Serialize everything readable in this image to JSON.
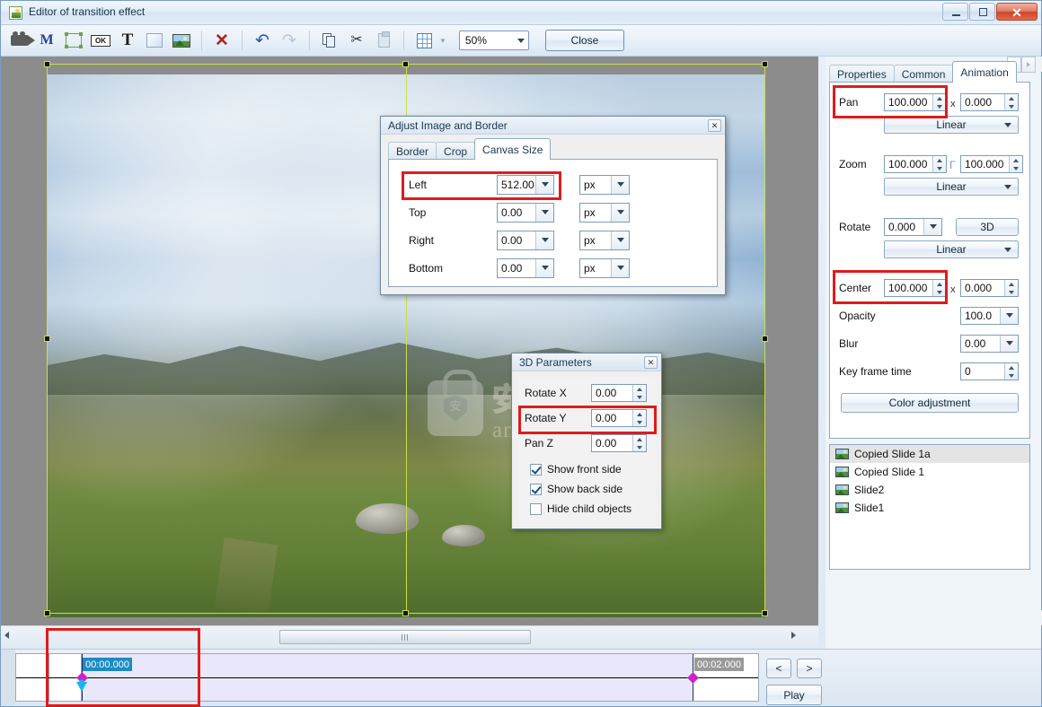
{
  "window": {
    "title": "Editor of transition effect",
    "icon": "app-icon",
    "minimize": "minimize-icon",
    "maximize": "maximize-icon",
    "close": "✕"
  },
  "toolbar": {
    "items": [
      {
        "name": "video-camera-icon",
        "label": ""
      },
      {
        "name": "mask-m-icon",
        "label": "M"
      },
      {
        "name": "selection-frame-icon",
        "label": ""
      },
      {
        "name": "button-ok-icon",
        "label": "OK"
      },
      {
        "name": "text-tool-icon",
        "label": "T"
      },
      {
        "name": "rectangle-tool-icon",
        "label": ""
      },
      {
        "name": "insert-image-icon",
        "label": ""
      },
      {
        "name": "delete-icon",
        "label": "✕"
      },
      {
        "name": "undo-icon",
        "label": "↶"
      },
      {
        "name": "redo-icon",
        "label": "↷"
      },
      {
        "name": "copy-icon",
        "label": ""
      },
      {
        "name": "cut-icon",
        "label": "✂"
      },
      {
        "name": "paste-icon",
        "label": ""
      },
      {
        "name": "grid-icon",
        "label": ""
      }
    ],
    "zoom_value": "50%",
    "close_label": "Close"
  },
  "panel": {
    "tabs": [
      {
        "label": "Properties",
        "active": false
      },
      {
        "label": "Common",
        "active": false
      },
      {
        "label": "Animation",
        "active": true
      }
    ],
    "nav_prev": "◀",
    "nav_next": "▶",
    "rows": {
      "pan": {
        "label": "Pan",
        "value1": "100.000",
        "sep": "x",
        "value2": "0.000",
        "easing": "Linear",
        "highlight": true
      },
      "zoom": {
        "label": "Zoom",
        "value1": "100.000",
        "link": "Γ",
        "value2": "100.000",
        "easing": "Linear",
        "highlight": false
      },
      "rotate": {
        "label": "Rotate",
        "value1": "0.000",
        "button3d": "3D",
        "easing": "Linear",
        "highlight": false
      },
      "center": {
        "label": "Center",
        "value1": "100.000",
        "sep": "x",
        "value2": "0.000",
        "highlight": true
      },
      "opacity": {
        "label": "Opacity",
        "value1": "100.0"
      },
      "blur": {
        "label": "Blur",
        "value1": "0.00"
      },
      "keyframe": {
        "label": "Key frame time",
        "value1": "0"
      }
    },
    "color_adjustment_label": "Color adjustment"
  },
  "slides": {
    "items": [
      {
        "label": "Copied Slide 1a",
        "selected": true
      },
      {
        "label": "Copied Slide 1",
        "selected": false
      },
      {
        "label": "Slide2",
        "selected": false
      },
      {
        "label": "Slide1",
        "selected": false
      }
    ]
  },
  "adjust_dialog": {
    "title": "Adjust Image and Border",
    "close": "✕",
    "tabs": [
      {
        "label": "Border",
        "active": false
      },
      {
        "label": "Crop",
        "active": false
      },
      {
        "label": "Canvas Size",
        "active": true
      }
    ],
    "fields": [
      {
        "label": "Left",
        "value": "512.00",
        "unit": "px",
        "highlight": true
      },
      {
        "label": "Top",
        "value": "0.00",
        "unit": "px",
        "highlight": false
      },
      {
        "label": "Right",
        "value": "0.00",
        "unit": "px",
        "highlight": false
      },
      {
        "label": "Bottom",
        "value": "0.00",
        "unit": "px",
        "highlight": false
      }
    ]
  },
  "params_dialog": {
    "title": "3D Parameters",
    "close": "✕",
    "fields": [
      {
        "label": "Rotate X",
        "value": "0.00",
        "highlight": false
      },
      {
        "label": "Rotate Y",
        "value": "0.00",
        "highlight": true
      },
      {
        "label": "Pan Z",
        "value": "0.00",
        "highlight": false
      }
    ],
    "checkboxes": [
      {
        "label": "Show front side",
        "checked": true
      },
      {
        "label": "Show back side",
        "checked": true
      },
      {
        "label": "Hide child objects",
        "checked": false
      }
    ]
  },
  "timeline": {
    "start_time": "00:00.000",
    "end_time": "00:02.000",
    "prev_label": "<",
    "next_label": ">",
    "play_label": "Play"
  },
  "watermark": {
    "text": "anxz.com",
    "cn": "安下载",
    "shield": "安"
  },
  "colors": {
    "highlight": "#e01b1b",
    "accent": "#1c8bc4",
    "selection": "#c8e04a"
  }
}
